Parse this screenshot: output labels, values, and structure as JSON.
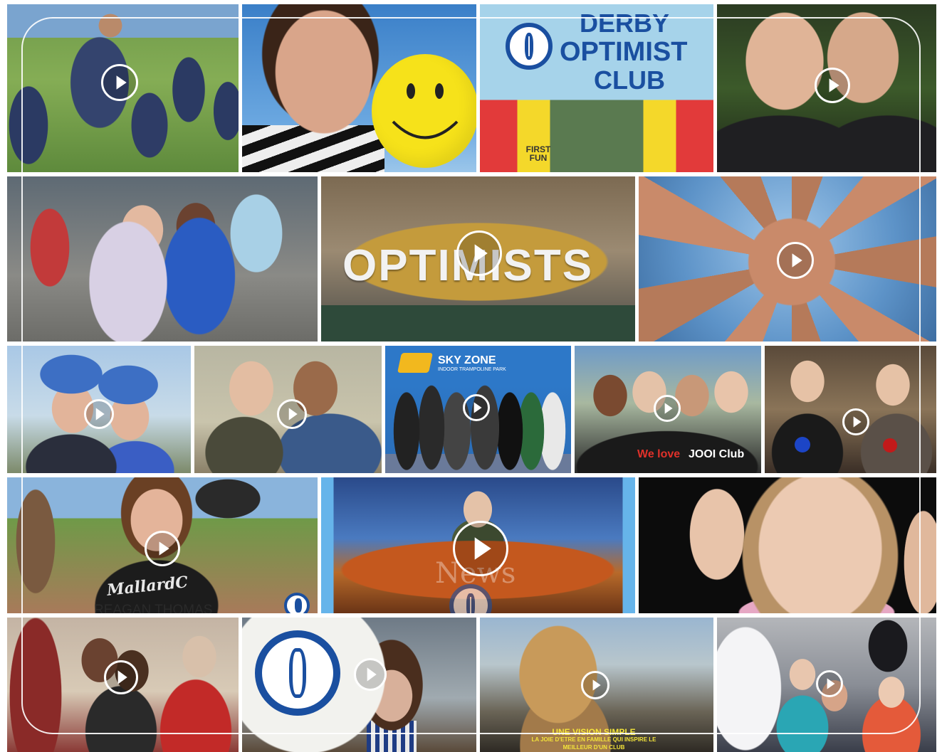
{
  "collage": {
    "banner": {
      "line1": "DERBY",
      "line2": "OPTIMIST",
      "line3": "CLUB",
      "tshirt": "FIRST FUN"
    },
    "sign_letters": "OPTIMISTS",
    "captions": {
      "sky_zone": "SKY ZONE",
      "sky_zone_sub": "INDOOR TRAMPOLINE PARK",
      "jooi_we_love": "We love",
      "jooi_club": "JOOI Club",
      "reagan": "REAGAN THOMAS",
      "shirt_text": "MallardC",
      "news_watermark": "News",
      "french_line1": "UNE VISION SIMPLE",
      "french_line2": "LA JOIE D'ETRE EN FAMILLE QUI INSPIRE LE",
      "french_line3": "MEILLEUR D'UN CLUB"
    }
  },
  "colors": {
    "optimist_blue": "#1a4fa0",
    "smiley_yellow": "#f6e21a",
    "caption_yellow": "#f4e43a",
    "jooi_red": "#e0312a"
  }
}
